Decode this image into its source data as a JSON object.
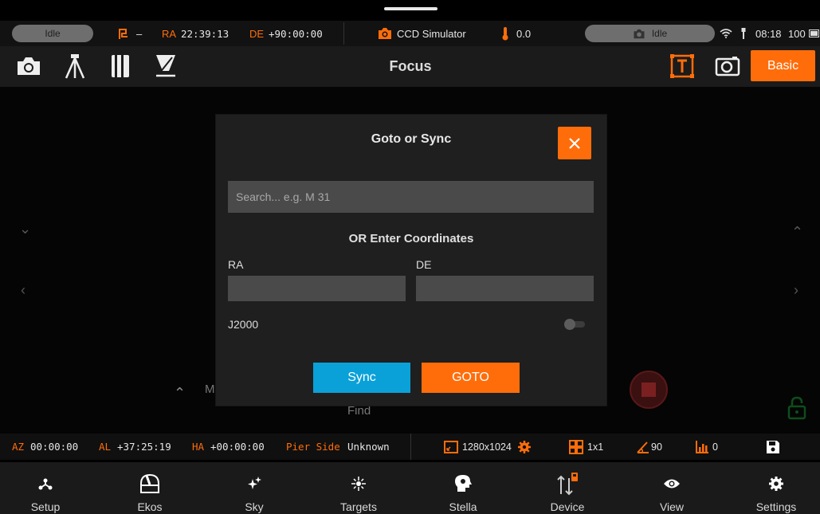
{
  "status": {
    "left_state": "Idle",
    "pier_dash": "–",
    "ra_label": "RA",
    "ra_value": "22:39:13",
    "de_label": "DE",
    "de_value": "+90:00:00",
    "camera_name": "CCD Simulator",
    "temperature": "0.0",
    "camera_state": "Idle",
    "time": "08:18",
    "battery": "100"
  },
  "toolbar": {
    "title": "Focus",
    "basic_label": "Basic"
  },
  "background": {
    "partial_label": "M",
    "find_label": "Find"
  },
  "dialog": {
    "title": "Goto or Sync",
    "search_placeholder": "Search... e.g. M 31",
    "or_label": "OR Enter Coordinates",
    "ra_label": "RA",
    "de_label": "DE",
    "ra_value": "",
    "de_value": "",
    "epoch_label": "J2000",
    "epoch_toggle_on": false,
    "sync_label": "Sync",
    "goto_label": "GOTO"
  },
  "infobar": {
    "az_label": "AZ",
    "az_value": "00:00:00",
    "al_label": "AL",
    "al_value": "+37:25:19",
    "ha_label": "HA",
    "ha_value": "+00:00:00",
    "pier_label": "Pier Side",
    "pier_value": "Unknown",
    "resolution": "1280x1024",
    "binning": "1x1",
    "angle": "90",
    "offset": "0"
  },
  "nav": [
    {
      "label": "Setup",
      "icon": "setup-icon"
    },
    {
      "label": "Ekos",
      "icon": "ekos-icon"
    },
    {
      "label": "Sky",
      "icon": "sky-icon"
    },
    {
      "label": "Targets",
      "icon": "targets-icon"
    },
    {
      "label": "Stella",
      "icon": "stella-icon"
    },
    {
      "label": "Device",
      "icon": "device-icon"
    },
    {
      "label": "View",
      "icon": "view-icon"
    },
    {
      "label": "Settings",
      "icon": "settings-icon"
    }
  ],
  "colors": {
    "accent": "#ff6d0a",
    "sync": "#0aa1d8",
    "panel": "#1f1f1f"
  }
}
